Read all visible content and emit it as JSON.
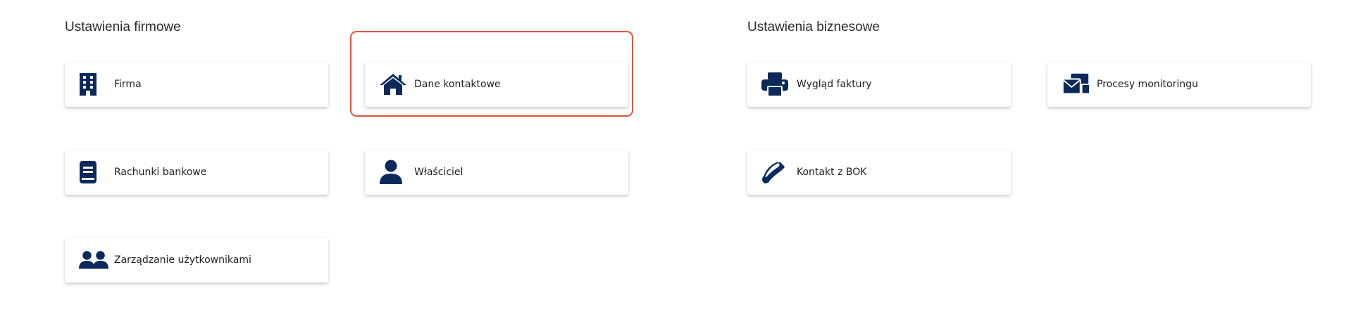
{
  "sections": {
    "company": {
      "title": "Ustawienia firmowe",
      "tiles": [
        {
          "label": "Firma",
          "icon": "building-icon"
        },
        {
          "label": "Dane kontaktowe",
          "icon": "home-icon"
        },
        {
          "label": "Rachunki bankowe",
          "icon": "book-icon"
        },
        {
          "label": "Właściciel",
          "icon": "user-icon"
        },
        {
          "label": "Zarządzanie użytkownikami",
          "icon": "users-icon"
        }
      ]
    },
    "business": {
      "title": "Ustawienia biznesowe",
      "tiles": [
        {
          "label": "Wygląd faktury",
          "icon": "printer-icon"
        },
        {
          "label": "Procesy monitoringu",
          "icon": "mail-monitoring-icon"
        },
        {
          "label": "Kontakt z BOK",
          "icon": "phone-icon"
        }
      ]
    }
  },
  "colors": {
    "icon": "#0b2a5b",
    "highlight": "#e0573a"
  }
}
